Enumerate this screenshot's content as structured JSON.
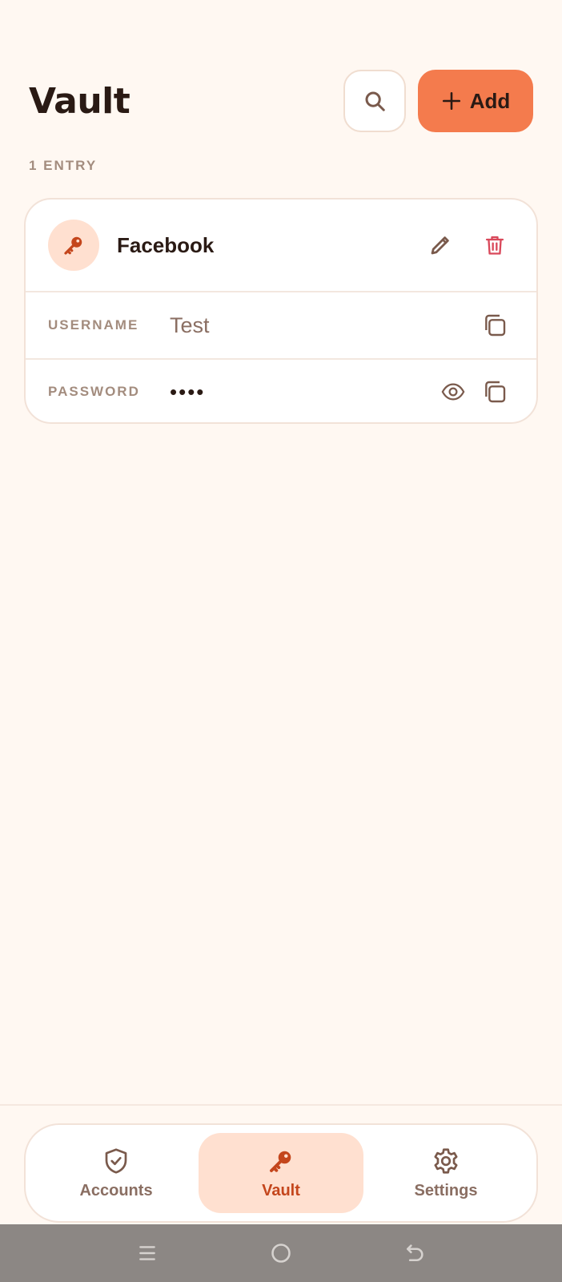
{
  "header": {
    "title": "Vault",
    "add_label": "Add"
  },
  "entries_count": "1 ENTRY",
  "entry": {
    "name": "Facebook",
    "username_label": "USERNAME",
    "username_value": "Test",
    "password_label": "PASSWORD",
    "password_value": "••••"
  },
  "nav": {
    "items": [
      {
        "label": "Accounts",
        "icon": "shield-check-icon",
        "active": false
      },
      {
        "label": "Vault",
        "icon": "key-icon",
        "active": true
      },
      {
        "label": "Settings",
        "icon": "gear-icon",
        "active": false
      }
    ]
  },
  "colors": {
    "background": "#FFF8F2",
    "accent": "#F47B4D",
    "accent_dark": "#C4461C",
    "accent_soft": "#FFE0D0",
    "danger": "#D9485A"
  }
}
